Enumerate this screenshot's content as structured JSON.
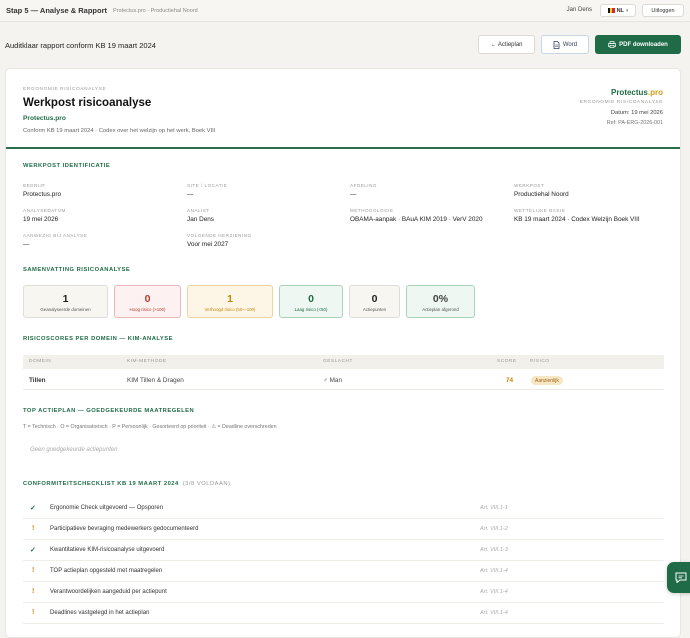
{
  "topbar": {
    "step_title": "Stap 5 — Analyse & Rapport",
    "step_sub": "Protectus.pro · Productiehal Noord",
    "user_name": "Jan Dens",
    "lang_label": "NL",
    "logout_label": "Uitloggen"
  },
  "header": {
    "title": "Auditklaar rapport conform KB 19 maart 2024",
    "back_label": "← Actieplan",
    "word_label": "Word",
    "pdf_label": "PDF downloaden"
  },
  "report": {
    "kicker": "ERGONOMIE RISICOANALYSE",
    "title": "Werkpost risicoanalyse",
    "brand_name": "Protectus",
    "brand_suffix": ".pro",
    "subtitle": "Conform KB 19 maart 2024 · Codex over het welzijn op het werk, Boek VIII",
    "right_kicker": "ERGONOMIE RISICOANALYSE",
    "date_line": "Datum: 19 mei 2026",
    "ref_line": "Ref: PA-ERG-2026-001"
  },
  "identification": {
    "section_title": "WERKPOST IDENTIFICATIE",
    "fields": [
      {
        "label": "BEDRIJF",
        "value": "Protectus.pro"
      },
      {
        "label": "SITE / LOCATIE",
        "value": "—"
      },
      {
        "label": "AFDELING",
        "value": "—"
      },
      {
        "label": "WERKPOST",
        "value": "Productiehal Noord"
      },
      {
        "label": "ANALYSEDATUM",
        "value": "19 mei 2026"
      },
      {
        "label": "ANALIST",
        "value": "Jan Dens"
      },
      {
        "label": "METHODOLOGIE",
        "value": "OBAMA-aanpak · BAuA KIM 2019 · VerV 2020"
      },
      {
        "label": "WETTELIJKE BASIS",
        "value": "KB 19 maart 2024 · Codex Welzijn Boek VIII"
      },
      {
        "label": "AANWEZIG BIJ ANALYSE",
        "value": "—"
      },
      {
        "label": "VOLGENDE HERZIENING",
        "value": "Voor mei 2027"
      }
    ]
  },
  "summary": {
    "section_title": "SAMENVATTING RISICOANALYSE",
    "boxes": [
      {
        "value": "1",
        "label": "Geanalyseerde domeinen"
      },
      {
        "value": "0",
        "label": "Hoog risico (>100)"
      },
      {
        "value": "1",
        "label": "Verhoogd risico (50—100)"
      },
      {
        "value": "0",
        "label": "Laag risico (<50)"
      },
      {
        "value": "0",
        "label": "Actiepunten"
      },
      {
        "value": "0%",
        "label": "Actieplan afgerond"
      }
    ]
  },
  "scores": {
    "section_title": "RISICOSCORES PER DOMEIN — KIM-ANALYSE",
    "columns": [
      "DOMEIN",
      "KIM-METHODE",
      "GESLACHT",
      "SCORE",
      "RISICO"
    ],
    "rows": [
      {
        "domein": "Tillen",
        "methode": "KIM Tillen & Dragen",
        "geslacht": "♂ Man",
        "score": "74",
        "risico": "Aanzienlijk"
      }
    ]
  },
  "actionplan": {
    "section_title": "TOP ACTIEPLAN — GOEDGEKEURDE MAATREGELEN",
    "legend": "T = Technisch · O = Organisatorisch · P = Persoonlijk · Gesorteerd op prioriteit · ⚠ = Deadline overschreden",
    "empty_text": "Geen goedgekeurde actiepunten"
  },
  "checklist": {
    "section_title": "CONFORMITEITSCHECKLIST KB 19 MAART 2024",
    "status": "(3/8 VOLDAAN)",
    "items": [
      {
        "status": "✓",
        "label": "Ergonomie Check uitgevoerd — Opsporen",
        "article": "Art. VIII.1-1"
      },
      {
        "status": "!",
        "label": "Participatieve bevraging medewerkers gedocumenteerd",
        "article": "Art. VIII.1-2"
      },
      {
        "status": "✓",
        "label": "Kwantitatieve KIM-risicoanalyse uitgevoerd",
        "article": "Art. VIII.1-3"
      },
      {
        "status": "!",
        "label": "TOP actieplan opgesteld met maatregelen",
        "article": "Art. VIII.1-4"
      },
      {
        "status": "!",
        "label": "Verantwoordelijken aangeduid per actiepunt",
        "article": "Art. VIII.1-4"
      },
      {
        "status": "!",
        "label": "Deadlines vastgelegd in het actieplan",
        "article": "Art. VIII.1-4"
      }
    ]
  },
  "colors": {
    "accent": "#1f6b47",
    "brand_pro": "#d39a1a",
    "high": "#c0392b",
    "elevated": "#c8860d",
    "low": "#1f6b47"
  }
}
